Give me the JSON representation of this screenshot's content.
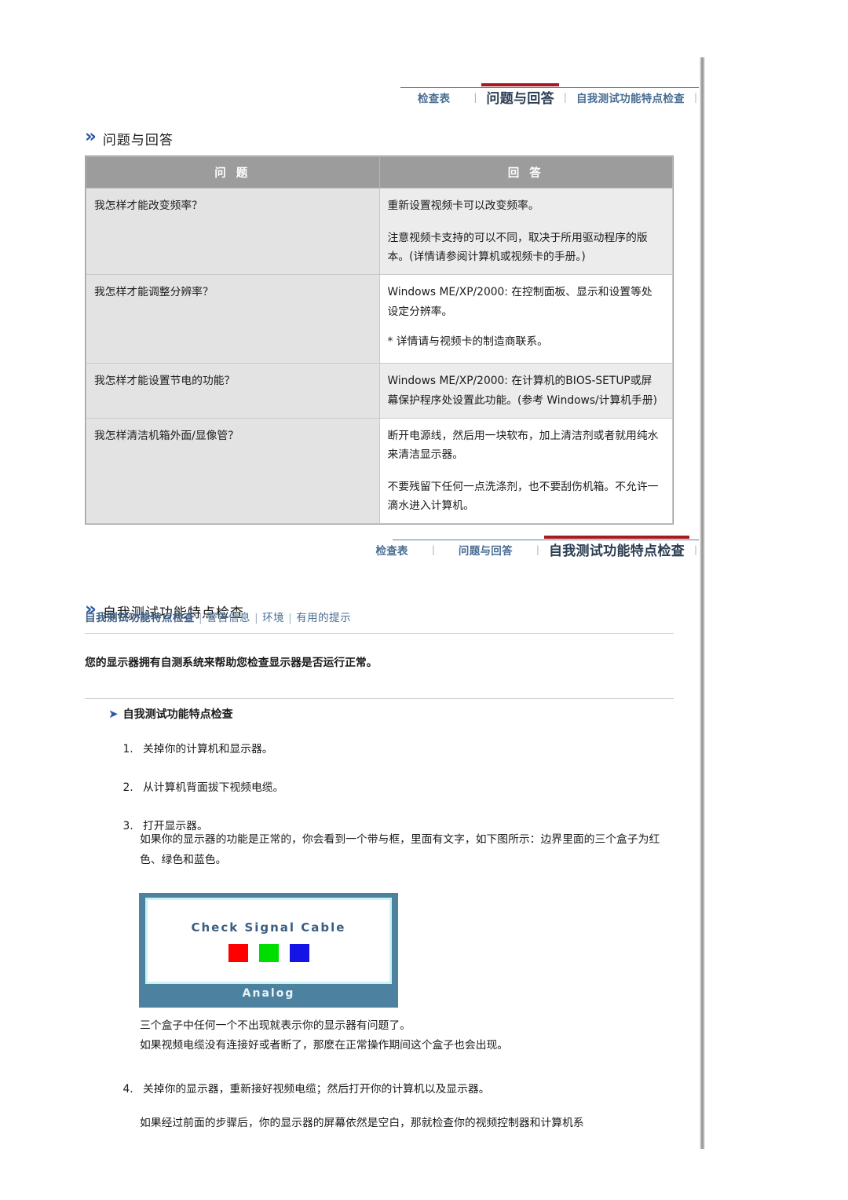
{
  "nav1": {
    "items": [
      {
        "label": "检查表",
        "active": false
      },
      {
        "label": "问题与回答",
        "active": true
      },
      {
        "label": "自我测试功能特点检查",
        "active": false
      }
    ],
    "separator": "|"
  },
  "nav2": {
    "items": [
      {
        "label": "检查表",
        "active": false
      },
      {
        "label": "问题与回答",
        "active": false
      },
      {
        "label": "自我测试功能特点检查",
        "active": true
      }
    ],
    "separator": "|"
  },
  "faq_section": {
    "chevron_icon": "»",
    "heading": "问题与回答",
    "columns": {
      "question": "问 题",
      "answer": "回 答"
    },
    "rows": [
      {
        "question": "我怎样才能改变频率？",
        "answer": [
          "重新设置视频卡可以改变频率。",
          "注意视频卡支持的可以不同，取决于所用驱动程序的版本。(详情请参阅计算机或视频卡的手册。)"
        ]
      },
      {
        "question": "我怎样才能调整分辨率？",
        "answer": [
          "Windows ME/XP/2000: 在控制面板、显示和设置等处设定分辨率。",
          "* 详情请与视频卡的制造商联系。"
        ]
      },
      {
        "question": "我怎样才能设置节电的功能？",
        "answer": [
          "Windows ME/XP/2000: 在计算机的BIOS-SETUP或屏幕保护程序处设置此功能。(参考 Windows/计算机手册)"
        ]
      },
      {
        "question": "我怎样清洁机箱外面/显像管？",
        "answer": [
          "断开电源线，然后用一块软布，加上清洁剂或者就用纯水来清洁显示器。",
          "不要残留下任何一点洗涤剂，也不要刮伤机箱。不允许一滴水进入计算机。"
        ]
      }
    ]
  },
  "selftest_section": {
    "chevron_icon": "»",
    "heading": "自我测试功能特点检查",
    "sublinks": [
      "自我测试功能特点检查",
      "警告信息",
      "环境",
      "有用的提示"
    ],
    "sublink_separator": "|",
    "intro": "您的显示器拥有自测系统来帮助您检查显示器是否运行正常。",
    "subhead_arrow_icon": "➤",
    "subhead": "自我测试功能特点检查",
    "steps": [
      "关掉你的计算机和显示器。",
      "从计算机背面拔下视频电缆。",
      "打开显示器。",
      "关掉你的显示器，重新接好视频电缆；然后打开你的计算机以及显示器。"
    ],
    "note_after_step3": "如果你的显示器的功能是正常的，你会看到一个带与框，里面有文字，如下图所示：边界里面的三个盒子为红色、绿色和蓝色。",
    "note_after_image_line1": "三个盒子中任何一个不出现就表示你的显示器有问题了。",
    "note_after_image_line2": "如果视频电缆没有连接好或者断了，那麽在正常操作期间这个盒子也会出现。",
    "note_after_step4": "如果经过前面的步骤后，你的显示器的屏幕依然是空白，那就检查你的视频控制器和计算机系",
    "monitor": {
      "message": "Check Signal Cable",
      "label": "Analog",
      "boxes": [
        {
          "name": "red-box",
          "color": "#ff0000"
        },
        {
          "name": "green-box",
          "color": "#00dd00"
        },
        {
          "name": "blue-box",
          "color": "#1414e6"
        }
      ],
      "bezel_color": "#4c82a0",
      "glow_color": "#c9f4f2"
    }
  },
  "colors": {
    "accent_red": "#a81a22",
    "link_blue": "#4a6d93",
    "chevron_blue": "#2d56a8",
    "table_header_gray": "#9c9c9c"
  }
}
